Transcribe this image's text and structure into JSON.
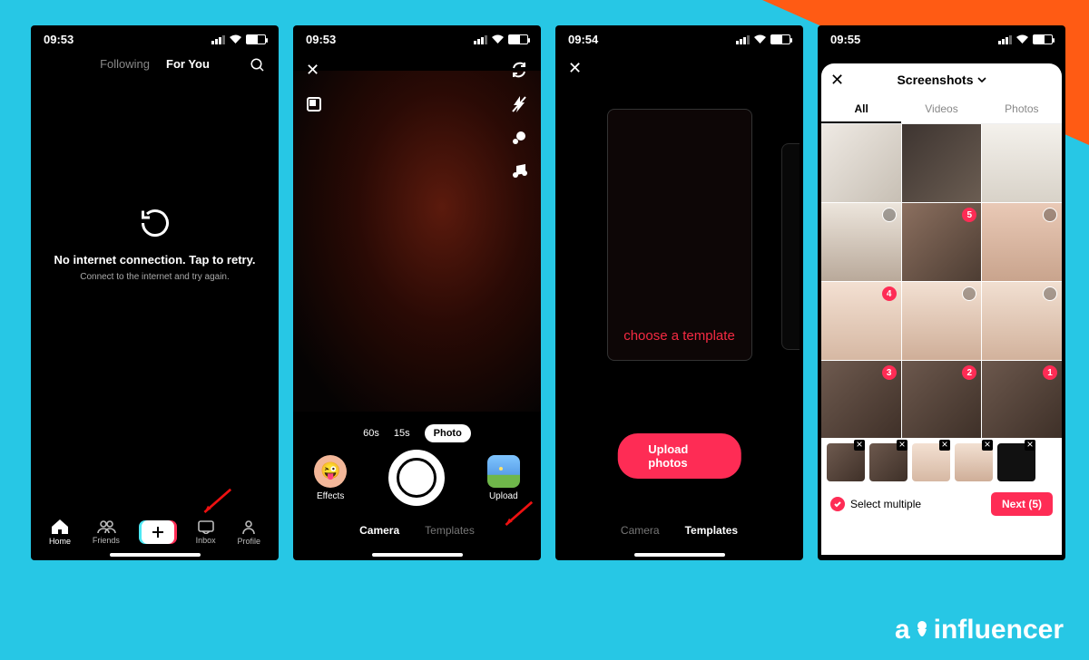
{
  "status": {
    "time1": "09:53",
    "time2": "09:53",
    "time3": "09:54",
    "time4": "09:55"
  },
  "phone1": {
    "tab_following": "Following",
    "tab_for_you": "For You",
    "retry_main": "No internet connection. Tap to retry.",
    "retry_sub": "Connect to the internet and try again.",
    "nav": {
      "home": "Home",
      "friends": "Friends",
      "inbox": "Inbox",
      "profile": "Profile"
    }
  },
  "phone2": {
    "dur_60": "60s",
    "dur_15": "15s",
    "dur_photo": "Photo",
    "effects": "Effects",
    "upload": "Upload",
    "mode_camera": "Camera",
    "mode_templates": "Templates"
  },
  "phone3": {
    "template_text": "choose a template",
    "upload_btn": "Upload photos",
    "mode_camera": "Camera",
    "mode_templates": "Templates"
  },
  "phone4": {
    "album_title": "Screenshots",
    "tab_all": "All",
    "tab_videos": "Videos",
    "tab_photos": "Photos",
    "select_multiple": "Select multiple",
    "next_label": "Next (5)",
    "selections": {
      "b1": "5",
      "b2": "4",
      "b3": "3",
      "b4": "2",
      "b5": "1"
    }
  },
  "watermark": "influencer"
}
